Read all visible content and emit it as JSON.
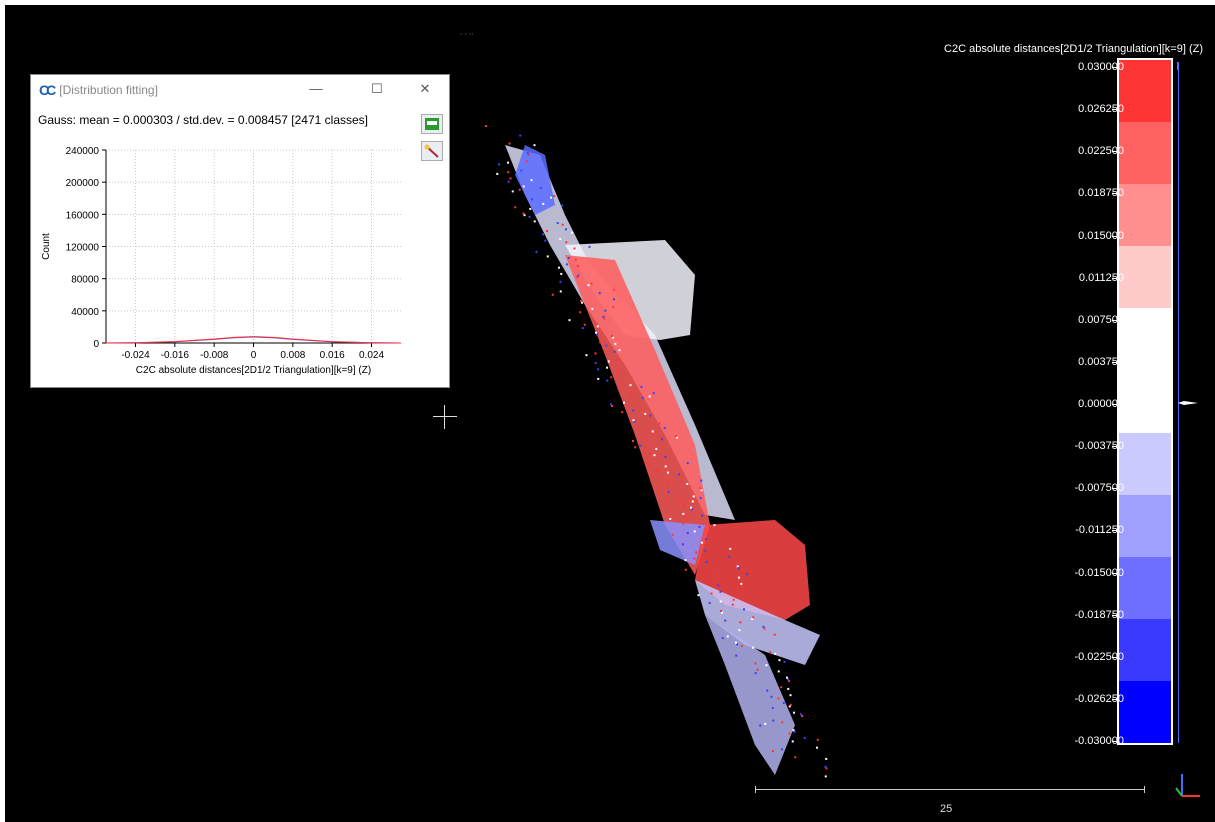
{
  "viewport": {
    "background": "#000000",
    "top_mark": "∙ ∙ ∙∙",
    "scale_label": "25"
  },
  "color_scale": {
    "title": "C2C absolute distances[2D1/2 Triangulation][k=9] (Z)",
    "ticks": [
      "0.030000",
      "0.026250",
      "0.022500",
      "0.018750",
      "0.015000",
      "0.011250",
      "0.007500",
      "0.003750",
      "0.000000",
      "-0.003750",
      "-0.007500",
      "-0.011250",
      "-0.015000",
      "-0.018750",
      "-0.022500",
      "-0.026250",
      "-0.030000"
    ],
    "bands": [
      "#ff3535",
      "#ff6060",
      "#ff8f8f",
      "#ffcaca",
      "#ffffff",
      "#cacaff",
      "#9f9fff",
      "#6f6fff",
      "#3a3aff",
      "#0000ff"
    ]
  },
  "dist_window": {
    "title": "[Distribution fitting]",
    "minimize": "—",
    "maximize": "☐",
    "close": "✕",
    "gauss_text": "Gauss: mean = 0.000303 / std.dev. = 0.008457 [2471 classes]",
    "export_icon": "csv-export-icon",
    "tool_icon": "pick-tool-icon"
  },
  "chart_data": {
    "type": "line",
    "title": "",
    "xlabel": "C2C absolute distances[2D1/2 Triangulation][k=9] (Z)",
    "ylabel": "Count",
    "xlim": [
      -0.03,
      0.03
    ],
    "ylim": [
      0,
      240000
    ],
    "x_ticks": [
      -0.024,
      -0.016,
      -0.008,
      0,
      0.008,
      0.016,
      0.024
    ],
    "x_tick_labels": [
      "-0.024",
      "-0.016",
      "-0.008",
      "0",
      "0.008",
      "0.016",
      "0.024"
    ],
    "y_ticks": [
      0,
      40000,
      80000,
      120000,
      160000,
      200000,
      240000
    ],
    "y_tick_labels": [
      "0",
      "40000",
      "80000",
      "120000",
      "160000",
      "200000",
      "240000"
    ],
    "grid": true,
    "series": [
      {
        "color": "#3a4dff",
        "x": [
          -0.03,
          -0.024,
          -0.016,
          -0.008,
          -0.004,
          0,
          0.004,
          0.008,
          0.016,
          0.024,
          0.03
        ],
        "values": [
          0,
          300,
          1500,
          4500,
          6500,
          7500,
          6500,
          4500,
          1500,
          300,
          0
        ]
      },
      {
        "color": "#ff3030",
        "x": [
          -0.03,
          -0.024,
          -0.016,
          -0.008,
          -0.004,
          0,
          0.004,
          0.008,
          0.016,
          0.024,
          0.03
        ],
        "values": [
          0,
          400,
          1800,
          5000,
          7000,
          8000,
          7000,
          5000,
          1800,
          400,
          0
        ]
      }
    ]
  }
}
